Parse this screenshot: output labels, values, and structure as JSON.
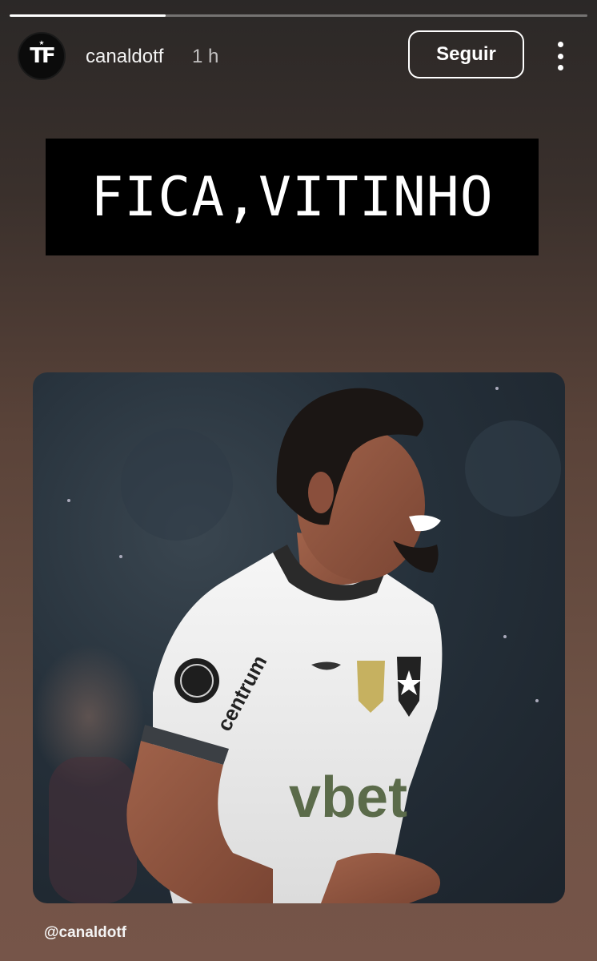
{
  "story": {
    "progress": 0.27
  },
  "header": {
    "avatar_text": "TF",
    "username": "canaldotf",
    "time": "1 h",
    "follow_label": "Seguir"
  },
  "post": {
    "title": "FICA,VITINHO",
    "jersey_sponsor": "vbet",
    "jersey_sleeve": "centrum",
    "mention": "@canaldotf"
  },
  "colors": {
    "title_bg": "#000000",
    "jersey": "#f1f1f1",
    "sponsor": "#5b6b4a"
  },
  "icons": {
    "more": "vertical-ellipsis-icon",
    "avatar": "tf-logo"
  }
}
